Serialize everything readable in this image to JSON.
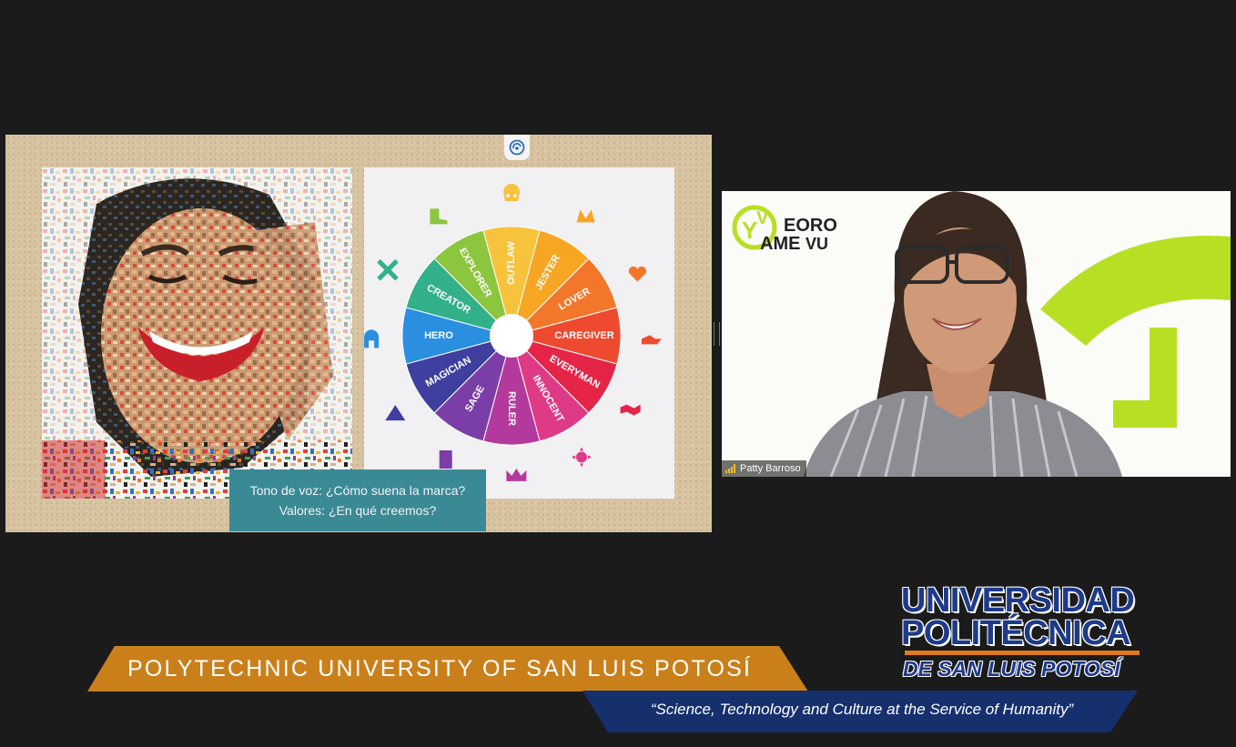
{
  "slide": {
    "caption_line1": "Tono de voz: ¿Cómo suena la marca?",
    "caption_line2": "Valores: ¿En qué creemos?",
    "share_icon": "screen-share-icon",
    "wheel": {
      "segments": [
        {
          "label": "OUTLAW",
          "color": "#f7c33c"
        },
        {
          "label": "JESTER",
          "color": "#f6a623"
        },
        {
          "label": "LOVER",
          "color": "#f3772b"
        },
        {
          "label": "CAREGIVER",
          "color": "#ee4a2f"
        },
        {
          "label": "EVERYMAN",
          "color": "#e52447"
        },
        {
          "label": "INNOCENT",
          "color": "#df3a86"
        },
        {
          "label": "RULER",
          "color": "#b33a9c"
        },
        {
          "label": "SAGE",
          "color": "#7b3ea6"
        },
        {
          "label": "MAGICIAN",
          "color": "#3e3f9e"
        },
        {
          "label": "HERO",
          "color": "#2b8fe0"
        },
        {
          "label": "CREATOR",
          "color": "#31b089"
        },
        {
          "label": "EXPLORER",
          "color": "#8cc63f"
        }
      ],
      "icons": [
        "skull-icon",
        "jester-hat-icon",
        "heart-icon",
        "helping-hand-icon",
        "handshake-icon",
        "sun-icon",
        "crown-icon",
        "book-icon",
        "wizard-hat-icon",
        "spartan-helmet-icon",
        "crossed-tools-icon",
        "boot-icon"
      ],
      "icon_colors": {
        "skull": "#f7c33c",
        "jester": "#f6a623",
        "heart": "#f3772b",
        "hand": "#ee4a2f",
        "handshake": "#e52447",
        "sun": "#df3a86",
        "crown": "#b33a9c",
        "book": "#7b3ea6",
        "wizard": "#3e3f9e",
        "helmet": "#2b8fe0",
        "tools": "#31b089",
        "boot": "#8cc63f"
      }
    }
  },
  "video": {
    "participant_name": "Patty Barroso",
    "logo_text_top": "EORO",
    "logo_text_bottom": "AME",
    "logo_letter_v": "V",
    "logo_letter_y": "Y",
    "logo_letters_right": "VU",
    "accent_color": "#b7e024"
  },
  "lower_third": {
    "university_en": "POLYTECHNIC UNIVERSITY OF SAN LUIS POTOSÍ",
    "motto": "“Science, Technology and Culture at the Service of Humanity”",
    "logo_line1": "UNIVERSIDAD",
    "logo_line2": "POLITÉCNICA",
    "logo_line3": "DE SAN LUIS POTOSÍ",
    "orange": "#c9801b",
    "navy": "#16306e"
  }
}
